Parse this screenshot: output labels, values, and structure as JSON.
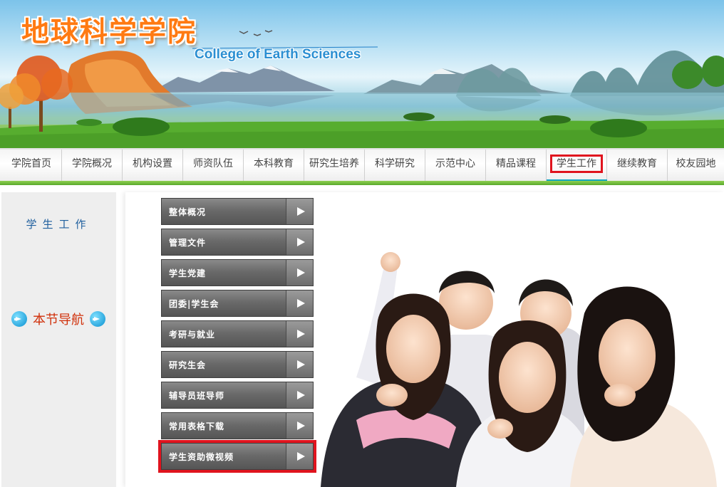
{
  "header": {
    "title": "地球科学学院",
    "subtitle": "College of Earth  Sciences"
  },
  "nav": {
    "items": [
      {
        "label": "学院首页",
        "active": false
      },
      {
        "label": "学院概况",
        "active": false
      },
      {
        "label": "机构设置",
        "active": false
      },
      {
        "label": "师资队伍",
        "active": false
      },
      {
        "label": "本科教育",
        "active": false
      },
      {
        "label": "研究生培养",
        "active": false
      },
      {
        "label": "科学研究",
        "active": false
      },
      {
        "label": "示范中心",
        "active": false
      },
      {
        "label": "精品课程",
        "active": false
      },
      {
        "label": "学生工作",
        "active": true
      },
      {
        "label": "继续教育",
        "active": false
      },
      {
        "label": "校友园地",
        "active": false
      }
    ],
    "active_color": "#e0141e",
    "underline_color": "#11a6c0"
  },
  "sidebar": {
    "title": "学生工作",
    "section_nav": "本节导航"
  },
  "menu": {
    "items": [
      {
        "label": "整体概况"
      },
      {
        "label": "管理文件"
      },
      {
        "label": "学生党建"
      },
      {
        "label": "团委|学生会"
      },
      {
        "label": "考研与就业"
      },
      {
        "label": "研究生会"
      },
      {
        "label": "辅导员班导师"
      },
      {
        "label": "常用表格下载"
      },
      {
        "label": "学生资助微视频",
        "highlighted": true
      }
    ]
  },
  "icons": {
    "menu_arrow": "play-arrow-icon",
    "section_arrow": "circle-arrow-right-icon"
  }
}
